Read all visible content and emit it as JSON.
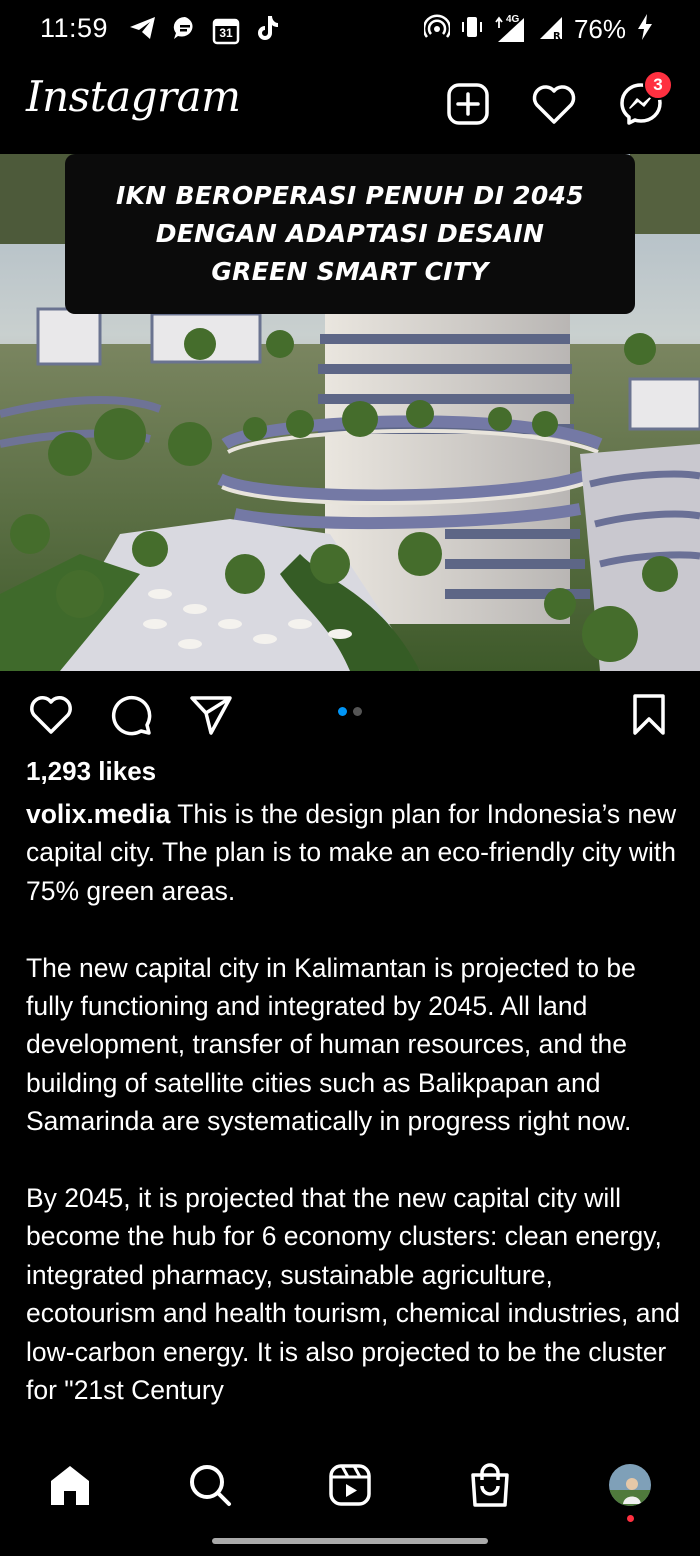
{
  "status_bar": {
    "time": "11:59",
    "icons_left": [
      "telegram-icon",
      "chat-bubble-icon",
      "calendar-icon",
      "tiktok-icon"
    ],
    "calendar_day": "31",
    "network_label": "4G",
    "battery_percent": "76%",
    "icons_right": [
      "hotspot-icon",
      "vibrate-icon",
      "signal-icon",
      "battery-charging-icon"
    ]
  },
  "header": {
    "logo": "Instagram",
    "messages_badge": "3"
  },
  "post": {
    "image_overlay_text": "IKN BEROPERASI PENUH DI 2045\nDENGAN ADAPTASI DESAIN\nGREEN SMART CITY",
    "carousel_count": 2,
    "carousel_active": 0,
    "likes": "1,293 likes",
    "username": "volix.media",
    "caption_first": "This is the design plan for Indonesia’s new capital city. The plan is to make an eco-friendly city with 75% green areas.",
    "caption_second": "The new capital city in Kalimantan is projected to be fully functioning and integrated by 2045. All land development, transfer of human resources, and the building of satellite cities such as Balikpapan and Samarinda are systematically in progress right now.",
    "caption_third": "By 2045, it is projected that the new capital city will become the hub for 6 economy clusters: clean energy, integrated pharmacy, sustainable agriculture, ecotourism and health tourism, chemical industries,  and low-carbon energy. It is also projected to be the cluster for \"21st Century"
  },
  "colors": {
    "background": "#000000",
    "accent_blue": "#0095f6",
    "badge_red": "#ff3040"
  }
}
